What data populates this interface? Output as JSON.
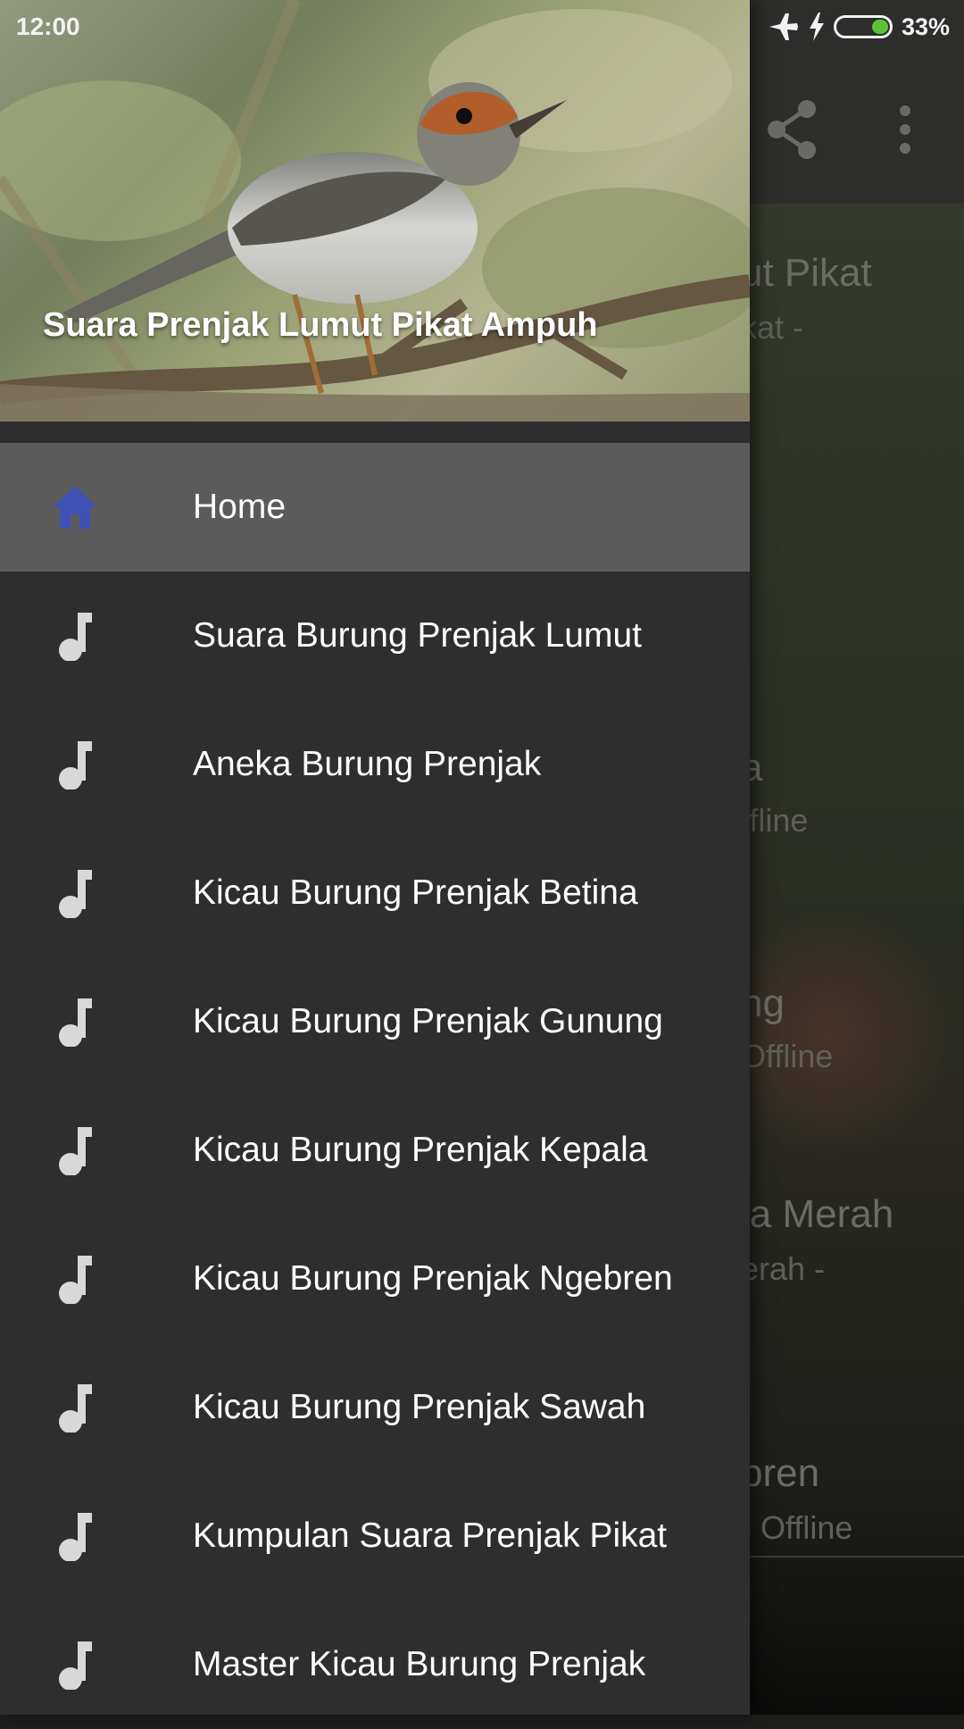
{
  "status_bar": {
    "time": "12:00",
    "battery_percent": "33%",
    "battery_level": 0.33,
    "icons": [
      "airplane-mode-icon",
      "charging-bolt-icon",
      "battery-icon"
    ]
  },
  "background_app": {
    "toolbar_icons": [
      "share-icon",
      "more-vert-icon"
    ],
    "partial_items": [
      {
        "title": "ut Pikat",
        "subtitle": "kat -"
      },
      {
        "title": "a",
        "subtitle": "ffline"
      },
      {
        "title": "ng",
        "subtitle": "Offline"
      },
      {
        "title": "la Merah",
        "subtitle": "erah -"
      },
      {
        "title": "bren",
        "subtitle": "- Offline"
      }
    ]
  },
  "drawer": {
    "header_title": "Suara Prenjak Lumut Pikat Ampuh",
    "menu": [
      {
        "label": "Home",
        "icon": "home-icon",
        "active": true
      },
      {
        "label": "Suara Burung Prenjak Lumut",
        "icon": "music-note-icon"
      },
      {
        "label": "Aneka Burung Prenjak",
        "icon": "music-note-icon"
      },
      {
        "label": "Kicau Burung Prenjak Betina",
        "icon": "music-note-icon"
      },
      {
        "label": "Kicau Burung Prenjak Gunung",
        "icon": "music-note-icon"
      },
      {
        "label": "Kicau Burung Prenjak Kepala",
        "icon": "music-note-icon"
      },
      {
        "label": "Kicau Burung Prenjak Ngebren",
        "icon": "music-note-icon"
      },
      {
        "label": "Kicau Burung Prenjak Sawah",
        "icon": "music-note-icon"
      },
      {
        "label": "Kumpulan Suara Prenjak Pikat",
        "icon": "music-note-icon"
      },
      {
        "label": "Master Kicau Burung Prenjak",
        "icon": "music-note-icon"
      }
    ]
  },
  "colors": {
    "drawer_bg": "#2e2e2e",
    "active_item_bg": "#5b5b5b",
    "home_icon": "#3f51b5",
    "note_icon": "#d8d8d8",
    "battery_fill": "#5bc236"
  }
}
